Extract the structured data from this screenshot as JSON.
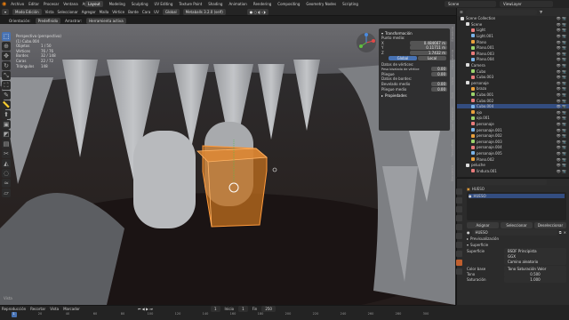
{
  "topbar": {
    "menus": [
      "Archivo",
      "Editar",
      "Procesar",
      "Ventana",
      "Ayuda"
    ],
    "workspaces": [
      "Layout",
      "Modeling",
      "Sculpting",
      "UV Editing",
      "Texture Paint",
      "Shading",
      "Animation",
      "Rendering",
      "Compositing",
      "Geometry Nodes",
      "Scripting"
    ],
    "active_workspace": "Layout",
    "scene_label": "Scene",
    "view_layer_label": "ViewLayer"
  },
  "viewport_header": {
    "mode": "Modo Edición",
    "menus": [
      "Vista",
      "Seleccionar",
      "Agregar",
      "Malla",
      "Vértice",
      "Borde",
      "Cara",
      "UV"
    ],
    "orientation": "Global",
    "snapping": "Metaballs 3.2.0 (self)",
    "sub_items": [
      "Orientación:",
      "Predefinido",
      "Arrastrar:",
      "Herramienta activa"
    ]
  },
  "stats": {
    "view_title": "Perspectiva (perspectiva)",
    "object": "(1) Cubo.004",
    "rows": [
      {
        "label": "Objetos",
        "value": "1 / 50"
      },
      {
        "label": "Vértices",
        "value": "76 / 76"
      },
      {
        "label": "Bordes",
        "value": "32 / 148"
      },
      {
        "label": "Caras",
        "value": "22 / 72"
      },
      {
        "label": "Triángulos",
        "value": "148"
      }
    ]
  },
  "npanel": {
    "section_transform": "Transformación",
    "mean_vertex": "Punto medio:",
    "coords": [
      {
        "axis": "X",
        "value": "0.484667 m"
      },
      {
        "axis": "Y",
        "value": "0.11711 m"
      },
      {
        "axis": "Z",
        "value": "1.7432 m"
      }
    ],
    "space_global": "Global",
    "space_local": "Local",
    "vertex_data": "Datos de vértices:",
    "bevel_weight_vert": "Peso biselado de vértice",
    "bevel_weight_vert_val": "0.00",
    "crease_vert": "Pliegue",
    "crease_vert_val": "0.00",
    "edge_data": "Datos de bordes:",
    "bevel_weight_edge": "Bevelado medio",
    "bevel_weight_edge_val": "0.00",
    "crease_edge": "Pliegue medio",
    "crease_edge_val": "0.00",
    "section_props": "Propiedades"
  },
  "side_tabs": [
    "Elemento",
    "Herramienta",
    "Vista",
    "Edit",
    "Quad Remesher",
    "Retopoflow",
    "BlenderKit"
  ],
  "status_text": "Vista",
  "outliner": {
    "items": [
      {
        "label": "Scene Collection",
        "indent": 0
      },
      {
        "label": "Scene",
        "indent": 1
      },
      {
        "label": "Light",
        "indent": 2
      },
      {
        "label": "Light.001",
        "indent": 2
      },
      {
        "label": "Plano",
        "indent": 2
      },
      {
        "label": "Plano.001",
        "indent": 2
      },
      {
        "label": "Plano.003",
        "indent": 2
      },
      {
        "label": "Plano.004",
        "indent": 2
      },
      {
        "label": "Camera",
        "indent": 1
      },
      {
        "label": "Cubo",
        "indent": 2
      },
      {
        "label": "Cubo.003",
        "indent": 2
      },
      {
        "label": "personaje",
        "indent": 1
      },
      {
        "label": "brazo",
        "indent": 2
      },
      {
        "label": "Cubo.001",
        "indent": 2
      },
      {
        "label": "Cubo.002",
        "indent": 2
      },
      {
        "label": "Cubo.004",
        "indent": 2,
        "selected": true
      },
      {
        "label": "ojo",
        "indent": 2
      },
      {
        "label": "ojo.001",
        "indent": 2
      },
      {
        "label": "personaje",
        "indent": 2
      },
      {
        "label": "personaje.001",
        "indent": 2
      },
      {
        "label": "personaje.002",
        "indent": 2
      },
      {
        "label": "personaje.003",
        "indent": 2
      },
      {
        "label": "personaje.004",
        "indent": 2
      },
      {
        "label": "personaje.005",
        "indent": 2
      },
      {
        "label": "Plano.002",
        "indent": 2
      },
      {
        "label": "peluche",
        "indent": 1
      },
      {
        "label": "lindura.001",
        "indent": 2
      }
    ]
  },
  "properties": {
    "object_name": "HUESO",
    "material_slot": "HUESO",
    "buttons": [
      "Asignar",
      "Seleccionar",
      "Deseleccionar"
    ],
    "material_field": "HUESO",
    "preview_label": "Previsualización",
    "surface_label": "Superficie",
    "surface_field": "Superficie",
    "surface_value": "BSDF Principista",
    "distribution": "GGX",
    "subsurface_method": "Camino aleatorio",
    "base_color_label": "Color base",
    "base_color_value": "Tono Saturación Valor",
    "hue_label": "Tono",
    "hue_value": "0.500",
    "saturation_label": "Saturación",
    "saturation_value": "1.000"
  },
  "timeline": {
    "menus": [
      "Reproducción",
      "Recortar",
      "Vista",
      "Marcador"
    ],
    "ticks": [
      "0",
      "20",
      "40",
      "60",
      "80",
      "100",
      "120",
      "140",
      "160",
      "180",
      "200",
      "220",
      "240",
      "260",
      "280",
      "300"
    ],
    "current_frame": "1",
    "start_label": "Inicio",
    "start_value": "1",
    "end_label": "Fin",
    "end_value": "250"
  },
  "colors": {
    "accent": "#4772b3",
    "selected": "#ff8a2b",
    "bg": "#1d1d1d"
  }
}
